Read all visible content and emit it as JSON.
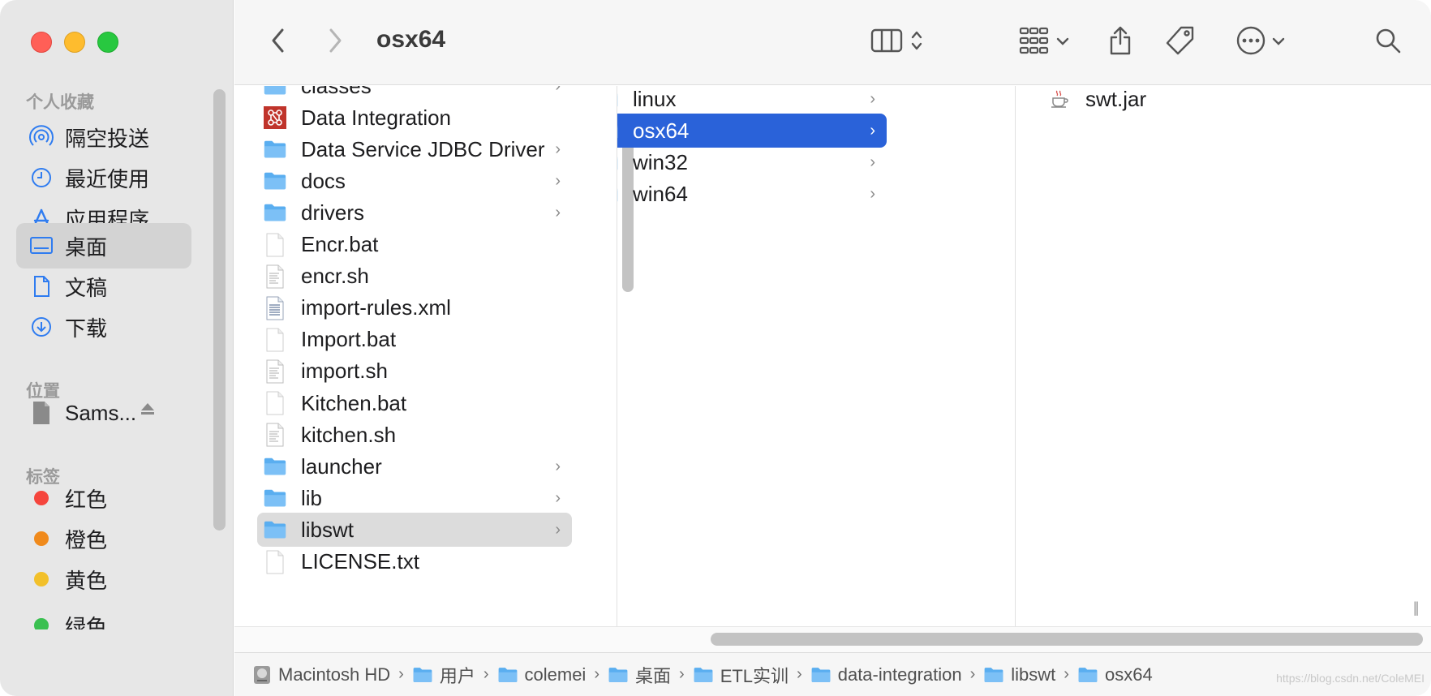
{
  "window": {
    "title": "osx64"
  },
  "toolbar": {
    "back_icon": "chevron-left-icon",
    "forward_icon": "chevron-right-icon",
    "view_icon": "column-view-icon",
    "group_icon": "group-grid-icon",
    "share_icon": "share-icon",
    "tag_icon": "tag-icon",
    "more_icon": "ellipsis-circle-icon",
    "search_icon": "search-icon"
  },
  "sidebar": {
    "favorites_title": "个人收藏",
    "favorites": [
      {
        "label": "隔空投送",
        "icon": "airdrop-icon"
      },
      {
        "label": "最近使用",
        "icon": "clock-icon"
      },
      {
        "label": "应用程序",
        "icon": "applications-icon"
      },
      {
        "label": "桌面",
        "icon": "desktop-icon",
        "selected": true
      },
      {
        "label": "文稿",
        "icon": "document-icon"
      },
      {
        "label": "下载",
        "icon": "download-icon"
      }
    ],
    "locations_title": "位置",
    "locations": [
      {
        "label": "Sams...",
        "icon": "drive-icon"
      }
    ],
    "tags_title": "标签",
    "tags": [
      {
        "label": "红色",
        "color": "#f5453d"
      },
      {
        "label": "橙色",
        "color": "#f08a1c"
      },
      {
        "label": "黄色",
        "color": "#f2c02a"
      },
      {
        "label": "绿色",
        "color": "#3ac050"
      }
    ]
  },
  "columns": {
    "col1": [
      {
        "name": "classes",
        "type": "folder",
        "chevron": true
      },
      {
        "name": "Data Integration",
        "type": "app",
        "chevron": false
      },
      {
        "name": "Data Service JDBC Driver",
        "type": "folder",
        "chevron": true
      },
      {
        "name": "docs",
        "type": "folder",
        "chevron": true
      },
      {
        "name": "drivers",
        "type": "folder",
        "chevron": true
      },
      {
        "name": "Encr.bat",
        "type": "file",
        "chevron": false
      },
      {
        "name": "encr.sh",
        "type": "script",
        "chevron": false
      },
      {
        "name": "import-rules.xml",
        "type": "xml",
        "chevron": false
      },
      {
        "name": "Import.bat",
        "type": "file",
        "chevron": false
      },
      {
        "name": "import.sh",
        "type": "script",
        "chevron": false
      },
      {
        "name": "Kitchen.bat",
        "type": "file",
        "chevron": false
      },
      {
        "name": "kitchen.sh",
        "type": "script",
        "chevron": false
      },
      {
        "name": "launcher",
        "type": "folder",
        "chevron": true
      },
      {
        "name": "lib",
        "type": "folder",
        "chevron": true
      },
      {
        "name": "libswt",
        "type": "folder",
        "chevron": true,
        "selected": "gray"
      },
      {
        "name": "LICENSE.txt",
        "type": "file",
        "chevron": false
      }
    ],
    "col2": [
      {
        "name": "linux",
        "type": "folder",
        "chevron": true
      },
      {
        "name": "osx64",
        "type": "folder",
        "chevron": true,
        "selected": "blue"
      },
      {
        "name": "win32",
        "type": "folder",
        "chevron": true
      },
      {
        "name": "win64",
        "type": "folder",
        "chevron": true
      }
    ],
    "col3": [
      {
        "name": "swt.jar",
        "type": "jar",
        "chevron": false
      }
    ]
  },
  "pathbar": [
    {
      "label": "Macintosh HD",
      "icon": "hard-drive-icon"
    },
    {
      "label": "用户",
      "icon": "folder-users-icon"
    },
    {
      "label": "colemei",
      "icon": "home-folder-icon"
    },
    {
      "label": "桌面",
      "icon": "desktop-folder-icon"
    },
    {
      "label": "ETL实训",
      "icon": "folder-icon"
    },
    {
      "label": "data-integration",
      "icon": "folder-icon"
    },
    {
      "label": "libswt",
      "icon": "folder-icon"
    },
    {
      "label": "osx64",
      "icon": "folder-icon"
    }
  ],
  "watermark": "https://blog.csdn.net/ColeMEI",
  "colors": {
    "selection_blue": "#2a62d9",
    "folder_blue": "#5aaef0",
    "sidebar_bg": "#e7e7e7"
  }
}
